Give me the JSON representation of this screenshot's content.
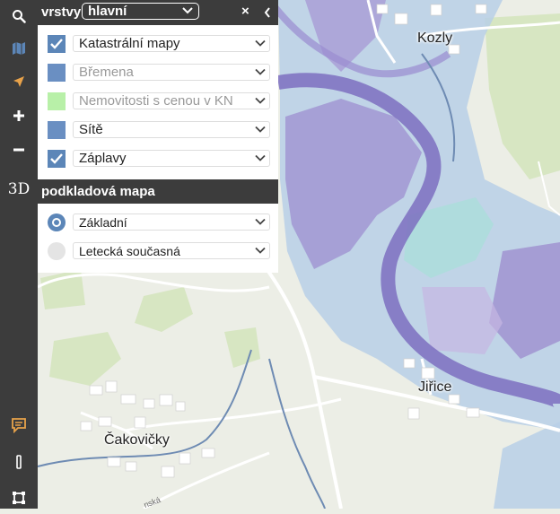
{
  "colors": {
    "toolbar_bg": "#3c3c3c",
    "checkbox": "#5c86b8",
    "swatch_bremena": "#6a8fc2",
    "swatch_nemovitosti": "#b8f0a8",
    "swatch_site": "#6a8fc2",
    "flood": "#8a78c8",
    "accent_icon": "#e8a24a"
  },
  "toolbar": {
    "tools": [
      {
        "name": "search",
        "icon": "search-icon"
      },
      {
        "name": "map",
        "icon": "map-icon"
      },
      {
        "name": "locate",
        "icon": "locate-arrow-icon"
      },
      {
        "name": "zoom-in",
        "icon": "plus-icon"
      },
      {
        "name": "zoom-out",
        "icon": "minus-icon"
      },
      {
        "name": "3d",
        "label": "3D"
      },
      {
        "name": "feedback",
        "icon": "comment-icon"
      },
      {
        "name": "measure",
        "icon": "ruler-icon"
      },
      {
        "name": "area",
        "icon": "square-select-icon"
      }
    ]
  },
  "panel": {
    "title": "vrstvy",
    "selected_set": "hlavní",
    "close_label": "×",
    "layers": [
      {
        "label": "Katastrální mapy",
        "state": "checked"
      },
      {
        "label": "Břemena",
        "state": "swatch",
        "dim": true
      },
      {
        "label": "Nemovitosti s cenou v KN",
        "state": "swatch",
        "dim": true
      },
      {
        "label": "Sítě",
        "state": "swatch",
        "dim": false
      },
      {
        "label": "Záplavy",
        "state": "checked"
      }
    ],
    "base_title": "podkladová mapa",
    "base_maps": [
      {
        "label": "Základní",
        "selected": true
      },
      {
        "label": "Letecká současná",
        "selected": false
      }
    ]
  },
  "map": {
    "places": [
      {
        "name": "Kozly"
      },
      {
        "name": "Jiřice"
      },
      {
        "name": "Čakovičky"
      }
    ],
    "street_fragment": "nská"
  }
}
